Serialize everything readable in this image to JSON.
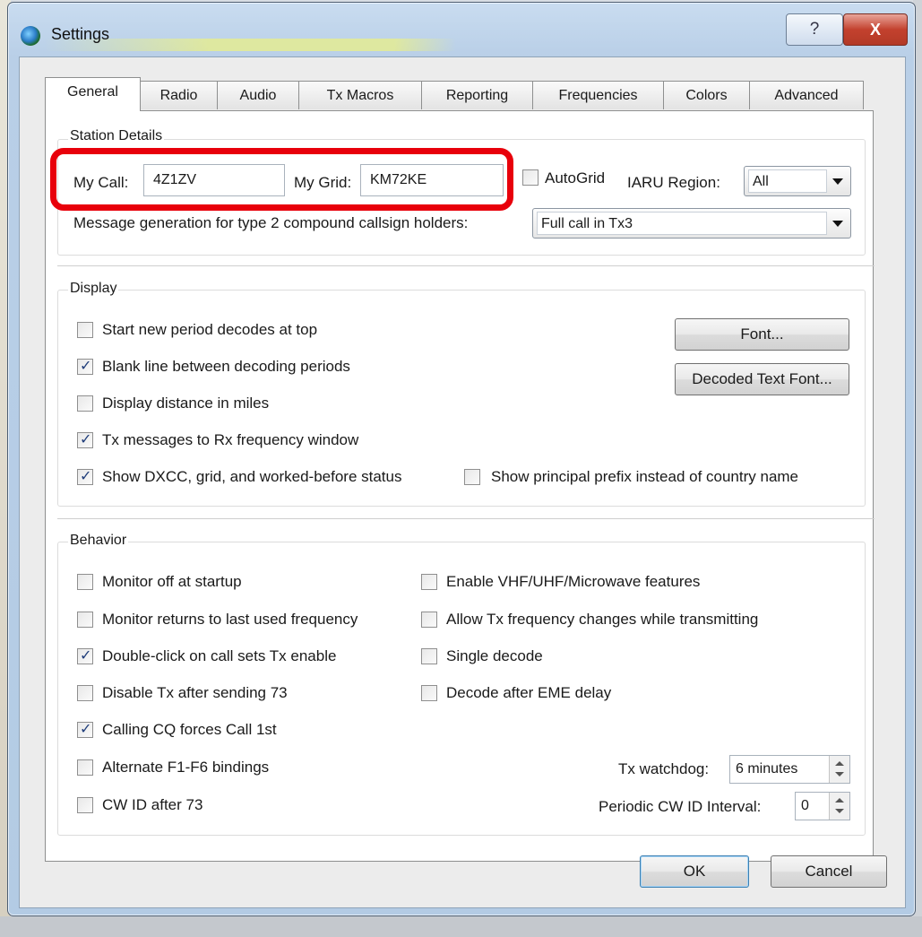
{
  "window": {
    "title": "Settings",
    "help_label": "?",
    "close_label": "X"
  },
  "tabs": [
    {
      "label": "General"
    },
    {
      "label": "Radio"
    },
    {
      "label": "Audio"
    },
    {
      "label": "Tx Macros"
    },
    {
      "label": "Reporting"
    },
    {
      "label": "Frequencies"
    },
    {
      "label": "Colors"
    },
    {
      "label": "Advanced"
    }
  ],
  "active_tab": "General",
  "station": {
    "group_label": "Station Details",
    "my_call_label": "My Call:",
    "my_call_value": "4Z1ZV",
    "my_grid_label": "My Grid:",
    "my_grid_value": "KM72KE",
    "autogrid_label": "AutoGrid",
    "autogrid_checked": false,
    "iaru_label": "IARU Region:",
    "iaru_value": "All",
    "msg_gen_label": "Message generation for type 2 compound callsign holders:",
    "msg_gen_value": "Full call in Tx3"
  },
  "display": {
    "group_label": "Display",
    "start_new_period": {
      "label": "Start new period decodes at top",
      "checked": false
    },
    "blank_line": {
      "label": "Blank line between decoding periods",
      "checked": true
    },
    "distance_miles": {
      "label": "Display distance in miles",
      "checked": false
    },
    "tx_to_rx": {
      "label": "Tx messages to Rx frequency window",
      "checked": true
    },
    "show_dxcc": {
      "label": "Show DXCC, grid, and worked-before status",
      "checked": true
    },
    "principal_prefix": {
      "label": "Show principal prefix instead of country name",
      "checked": false
    },
    "font_button": "Font...",
    "decoded_font_button": "Decoded Text Font..."
  },
  "behavior": {
    "group_label": "Behavior",
    "monitor_off": {
      "label": "Monitor off at startup",
      "checked": false
    },
    "monitor_returns": {
      "label": "Monitor returns to last used frequency",
      "checked": false
    },
    "double_click": {
      "label": "Double-click on call sets Tx enable",
      "checked": true
    },
    "disable_tx_73": {
      "label": "Disable Tx after sending 73",
      "checked": false
    },
    "calling_cq": {
      "label": "Calling CQ forces Call 1st",
      "checked": true
    },
    "alternate_f": {
      "label": "Alternate F1-F6 bindings",
      "checked": false
    },
    "cw_id": {
      "label": "CW ID after 73",
      "checked": false
    },
    "vhf_uhf": {
      "label": "Enable VHF/UHF/Microwave features",
      "checked": false
    },
    "allow_tx_freq": {
      "label": "Allow Tx frequency changes while transmitting",
      "checked": false
    },
    "single_decode": {
      "label": "Single decode",
      "checked": false
    },
    "decode_eme": {
      "label": "Decode after EME delay",
      "checked": false
    },
    "tx_watchdog_label": "Tx watchdog:",
    "tx_watchdog_value": "6 minutes",
    "cw_interval_label": "Periodic CW ID Interval:",
    "cw_interval_value": "0"
  },
  "footer": {
    "ok": "OK",
    "cancel": "Cancel"
  },
  "colors": {
    "highlight": "#e8000b",
    "check": "#1f3d7a"
  }
}
